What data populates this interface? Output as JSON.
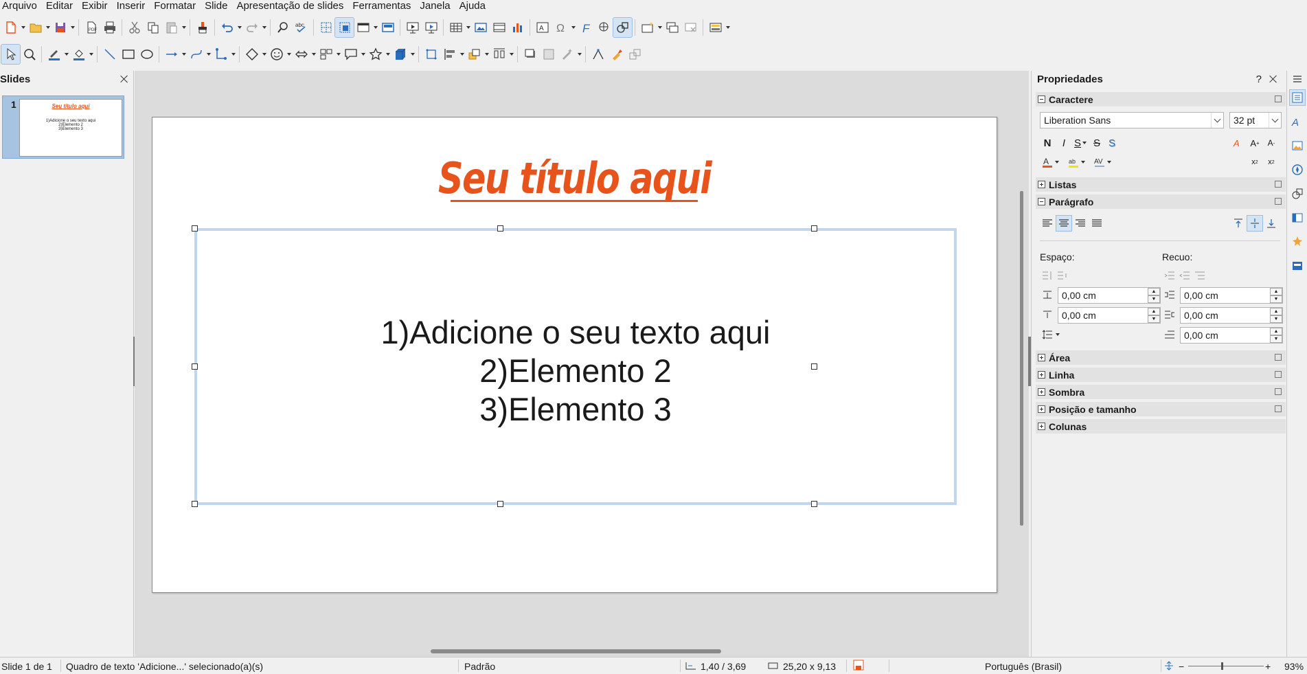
{
  "menu": [
    "Arquivo",
    "Editar",
    "Exibir",
    "Inserir",
    "Formatar",
    "Slide",
    "Apresentação de slides",
    "Ferramentas",
    "Janela",
    "Ajuda"
  ],
  "slides_pane": {
    "title": "Slides",
    "thumb_number": "1",
    "thumb_title": "Seu título aqui",
    "thumb_lines": [
      "1)Adicione o seu texto aqui",
      "2)Elemento 2",
      "3)Elemento 3"
    ]
  },
  "slide": {
    "title": "Seu título aqui",
    "body_lines": [
      "1)Adicione o seu texto aqui",
      "2)Elemento 2",
      "3)Elemento 3"
    ]
  },
  "properties": {
    "title": "Propriedades",
    "help": "?",
    "sections": {
      "caractere": "Caractere",
      "listas": "Listas",
      "paragrafo": "Parágrafo",
      "area": "Área",
      "linha": "Linha",
      "sombra": "Sombra",
      "posicao": "Posição e tamanho",
      "colunas": "Colunas"
    },
    "font_name": "Liberation Sans",
    "font_size": "32 pt",
    "bold": "N",
    "italic": "I",
    "underline": "S",
    "strike": "S",
    "shadow": "S",
    "espaco_label": "Espaço:",
    "recuo_label": "Recuo:",
    "spacing_above": "0,00 cm",
    "spacing_below": "0,00 cm",
    "indent_before": "0,00 cm",
    "indent_after": "0,00 cm",
    "indent_first": "0,00 cm"
  },
  "status": {
    "slide": "Slide 1 de 1",
    "selection": "Quadro de texto 'Adicione...' selecionado(a)(s)",
    "layout": "Padrão",
    "position": "1,40 / 3,69",
    "size": "25,20 x 9,13",
    "language": "Português (Brasil)",
    "zoom": "93%"
  },
  "colors": {
    "accent": "#e8531c",
    "selection_border": "#c1d6ec",
    "active_tab": "#d4e4f5"
  }
}
